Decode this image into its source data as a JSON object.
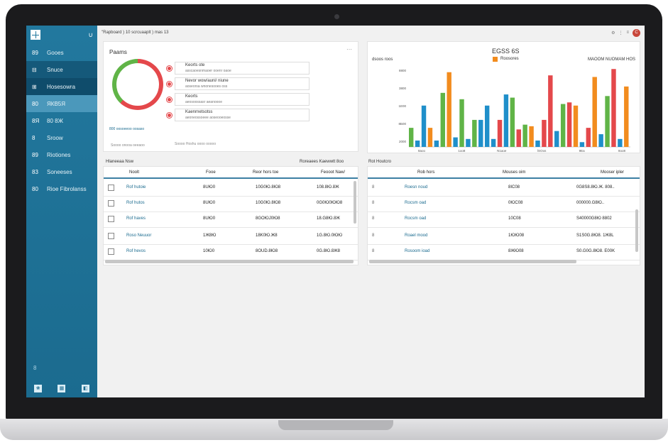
{
  "header": {
    "breadcrumb": "\"Rapboard ) 10 scrcuaaplt ) mas 13",
    "actions": [
      "⚙",
      "⋮",
      "≡"
    ],
    "avatar_initial": "C"
  },
  "sidebar": {
    "items": [
      {
        "icon": "89",
        "label": "Gooes"
      },
      {
        "icon": "⊟",
        "label": "Snuce"
      },
      {
        "icon": "⊞",
        "label": "Hosesowra"
      },
      {
        "icon": "80",
        "label": "ЯКВ5Я"
      },
      {
        "icon": "8Я",
        "label": "80 8Ж"
      },
      {
        "icon": "8",
        "label": "Sroow"
      },
      {
        "icon": "89",
        "label": "Riotiones"
      },
      {
        "icon": "83",
        "label": "Soneeses"
      },
      {
        "icon": "80",
        "label": "Rioe Fibrolanss"
      }
    ],
    "bottom_label": "8",
    "bottom_icons": [
      "❀",
      "▦",
      "◧"
    ]
  },
  "donut_card": {
    "title": "Paams",
    "menu": "⋯",
    "legend": [
      {
        "title": "Keorts ote",
        "sub": "asscaoesnmaoer ooenr oaoe"
      },
      {
        "title": "Nevor wow/auni/ niune",
        "sub": "aoseorsa wnonesooes oss"
      },
      {
        "title": "Keorts",
        "sub": "aeosoossasr aeanoooe"
      },
      {
        "title": "Kaenrnetsotss",
        "sub": "aeoneossoeee aoseooeosse"
      }
    ],
    "link": "800 oosoeeoo oosaso",
    "footer_left": "Soooo onooa  oeeaoo",
    "footer_right": "Soooo Hoshu oooo ooooo"
  },
  "bar_card": {
    "title": "ЕGSS 6S",
    "legend_label": "Roosores",
    "left_label": "dsoos roos",
    "right_label": "MAOOM NUOMAM HOS"
  },
  "chart_data": {
    "type": "bar",
    "y_ticks": [
      "8800",
      "3800",
      "1Е00",
      "8Б00",
      "2000"
    ],
    "x_ticks": [
      "8aoo",
      "1oo8",
      "N1aoe",
      "lSOos",
      "9Ea",
      "8oo8"
    ],
    "series_colors": [
      "#1f8fca",
      "#60b447",
      "#f28c1e",
      "#e4484b"
    ],
    "bars": [
      {
        "color": "#60b447",
        "value": 1200
      },
      {
        "color": "#1f8fca",
        "value": 400
      },
      {
        "color": "#1f8fca",
        "value": 2600
      },
      {
        "color": "#f28c1e",
        "value": 1200
      },
      {
        "color": "#1f8fca",
        "value": 400
      },
      {
        "color": "#60b447",
        "value": 3400
      },
      {
        "color": "#f28c1e",
        "value": 4700
      },
      {
        "color": "#1f8fca",
        "value": 600
      },
      {
        "color": "#60b447",
        "value": 3000
      },
      {
        "color": "#1f8fca",
        "value": 500
      },
      {
        "color": "#60b447",
        "value": 1700
      },
      {
        "color": "#1f8fca",
        "value": 1700
      },
      {
        "color": "#1f8fca",
        "value": 2600
      },
      {
        "color": "#1f8fca",
        "value": 500
      },
      {
        "color": "#e4484b",
        "value": 1700
      },
      {
        "color": "#1f8fca",
        "value": 3300
      },
      {
        "color": "#60b447",
        "value": 3100
      },
      {
        "color": "#e4484b",
        "value": 1100
      },
      {
        "color": "#60b447",
        "value": 1400
      },
      {
        "color": "#f28c1e",
        "value": 1300
      },
      {
        "color": "#1f8fca",
        "value": 400
      },
      {
        "color": "#e4484b",
        "value": 1700
      },
      {
        "color": "#e4484b",
        "value": 4500
      },
      {
        "color": "#1f8fca",
        "value": 1000
      },
      {
        "color": "#60b447",
        "value": 2700
      },
      {
        "color": "#e4484b",
        "value": 2800
      },
      {
        "color": "#f28c1e",
        "value": 2600
      },
      {
        "color": "#1f8fca",
        "value": 300
      },
      {
        "color": "#e4484b",
        "value": 1200
      },
      {
        "color": "#f28c1e",
        "value": 4400
      },
      {
        "color": "#1f8fca",
        "value": 800
      },
      {
        "color": "#60b447",
        "value": 3200
      },
      {
        "color": "#e4484b",
        "value": 4900
      },
      {
        "color": "#1f8fca",
        "value": 500
      },
      {
        "color": "#f28c1e",
        "value": 3800
      }
    ],
    "ylim": [
      0,
      5000
    ]
  },
  "table_left": {
    "caption_left": "Hlaneeaa Nsw",
    "caption_right": "Roreaees Kaewwtt 8oo",
    "columns": [
      "Noolt",
      "Fooe",
      "Reor hors toe",
      "Feooot Naw/"
    ],
    "rows": [
      {
        "name": "Rof hutoie",
        "c2": "8UЮ0",
        "c3": "10G0Ю.8Ю8",
        "c4": "108.8Ю.8Ж"
      },
      {
        "name": "Rof hutos",
        "c2": "8UЮ0",
        "c3": "10G0Ю.8Ю8",
        "c4": "0G0Ю0ЮЮ8"
      },
      {
        "name": "Rof haves",
        "c2": "8UЮ0",
        "c3": "8GOЮJ0Ю8",
        "c4": "18.G8Ю.8Ж"
      },
      {
        "name": "Roso Neuuor",
        "c2": "1Ж8Ю",
        "c3": "18K0Ю.Ж8",
        "c4": "1G.8Ю.0ЮЮ"
      },
      {
        "name": "Rof hevos",
        "c2": "10Ю0",
        "c3": "8OUD.8Ю8",
        "c4": "0G.8Ю.8Ж8"
      }
    ]
  },
  "table_right": {
    "caption_left": "Rot Houtcro",
    "columns": [
      "Rob hors",
      "Mouses oim",
      "Mooser ipler"
    ],
    "rows": [
      {
        "idx": "8",
        "name": "Roesn noud",
        "c2": "8IC08",
        "c3": "0G8S8.8Ю.Ж. 808.."
      },
      {
        "idx": "8",
        "name": "Rocsm oad",
        "c2": "0ЮC08",
        "c3": "000000.G8Ю.."
      },
      {
        "idx": "8",
        "name": "Rocsm oad",
        "c2": "10C08",
        "c3": "S40000G8Ю 8802"
      },
      {
        "idx": "8",
        "name": "Roael mood",
        "c2": "1ЮЮ08",
        "c3": "S1S0G.8Ю8. 1Ж8L"
      },
      {
        "idx": "8",
        "name": "Rosoom ioad",
        "c2": "8ЖЮ08",
        "c3": "S0.G0G.8Ю8. E00K"
      }
    ]
  }
}
